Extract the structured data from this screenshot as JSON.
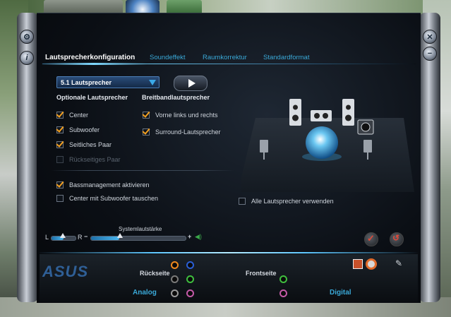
{
  "tabs": [
    {
      "label": "Lautsprecherkonfiguration",
      "active": true
    },
    {
      "label": "Soundeffekt",
      "active": false
    },
    {
      "label": "Raumkorrektur",
      "active": false
    },
    {
      "label": "Standardformat",
      "active": false
    }
  ],
  "speaker_select": {
    "value": "5.1 Lautsprecher"
  },
  "optional_speakers": {
    "heading": "Optionale Lautsprecher",
    "items": [
      {
        "label": "Center",
        "checked": true,
        "enabled": true
      },
      {
        "label": "Subwoofer",
        "checked": true,
        "enabled": true
      },
      {
        "label": "Seitliches Paar",
        "checked": true,
        "enabled": true
      },
      {
        "label": "Rückseitiges Paar",
        "checked": false,
        "enabled": false
      }
    ]
  },
  "fullrange_speakers": {
    "heading": "Breitbandlautsprecher",
    "items": [
      {
        "label": "Vorne links und rechts",
        "checked": true
      },
      {
        "label": "Surround-Lautsprecher",
        "checked": true
      }
    ]
  },
  "options": [
    {
      "label": "Bassmanagement aktivieren",
      "checked": true
    },
    {
      "label": "Center mit Subwoofer tauschen",
      "checked": false
    }
  ],
  "all_speakers": {
    "label": "Alle Lautsprecher verwenden",
    "checked": false
  },
  "balance": {
    "left_label": "L",
    "right_label": "R",
    "value": 0.5
  },
  "volume": {
    "label": "Systemlautstärke",
    "minus": "−",
    "plus": "+",
    "value": 0.3
  },
  "bottom": {
    "brand": "ASUS",
    "rear_label": "Rückseite",
    "front_label": "Frontseite",
    "analog_label": "Analog",
    "digital_label": "Digital"
  },
  "colors": {
    "accent": "#3aa9d8",
    "check": "#f4a020",
    "jack_orange": "#f08a1e",
    "jack_blue": "#2a5fd6",
    "jack_black": "#7a7a7a",
    "jack_green": "#3fbf3f",
    "jack_pink": "#c45aa8"
  }
}
